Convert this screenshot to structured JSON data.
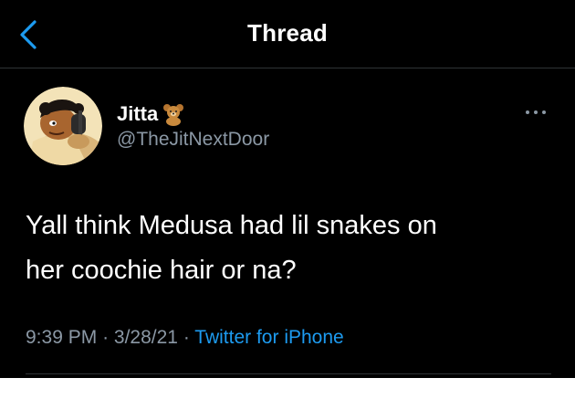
{
  "header": {
    "title": "Thread",
    "back_icon": "chevron-left-icon"
  },
  "tweet": {
    "display_name": "Jitta",
    "name_emoji": "teddy-bear-icon",
    "handle": "@TheJitNextDoor",
    "text_line1": "Yall think Medusa had lil snakes on",
    "text_line2": "her coochie hair or na?",
    "time": "9:39 PM",
    "date": "3/28/21",
    "separator": "·",
    "source": "Twitter for iPhone",
    "more_icon": "more-horizontal-icon"
  },
  "colors": {
    "background": "#000000",
    "text": "#ffffff",
    "muted": "#8b98a5",
    "accent": "#1d9bf0",
    "divider": "#2f3336"
  }
}
